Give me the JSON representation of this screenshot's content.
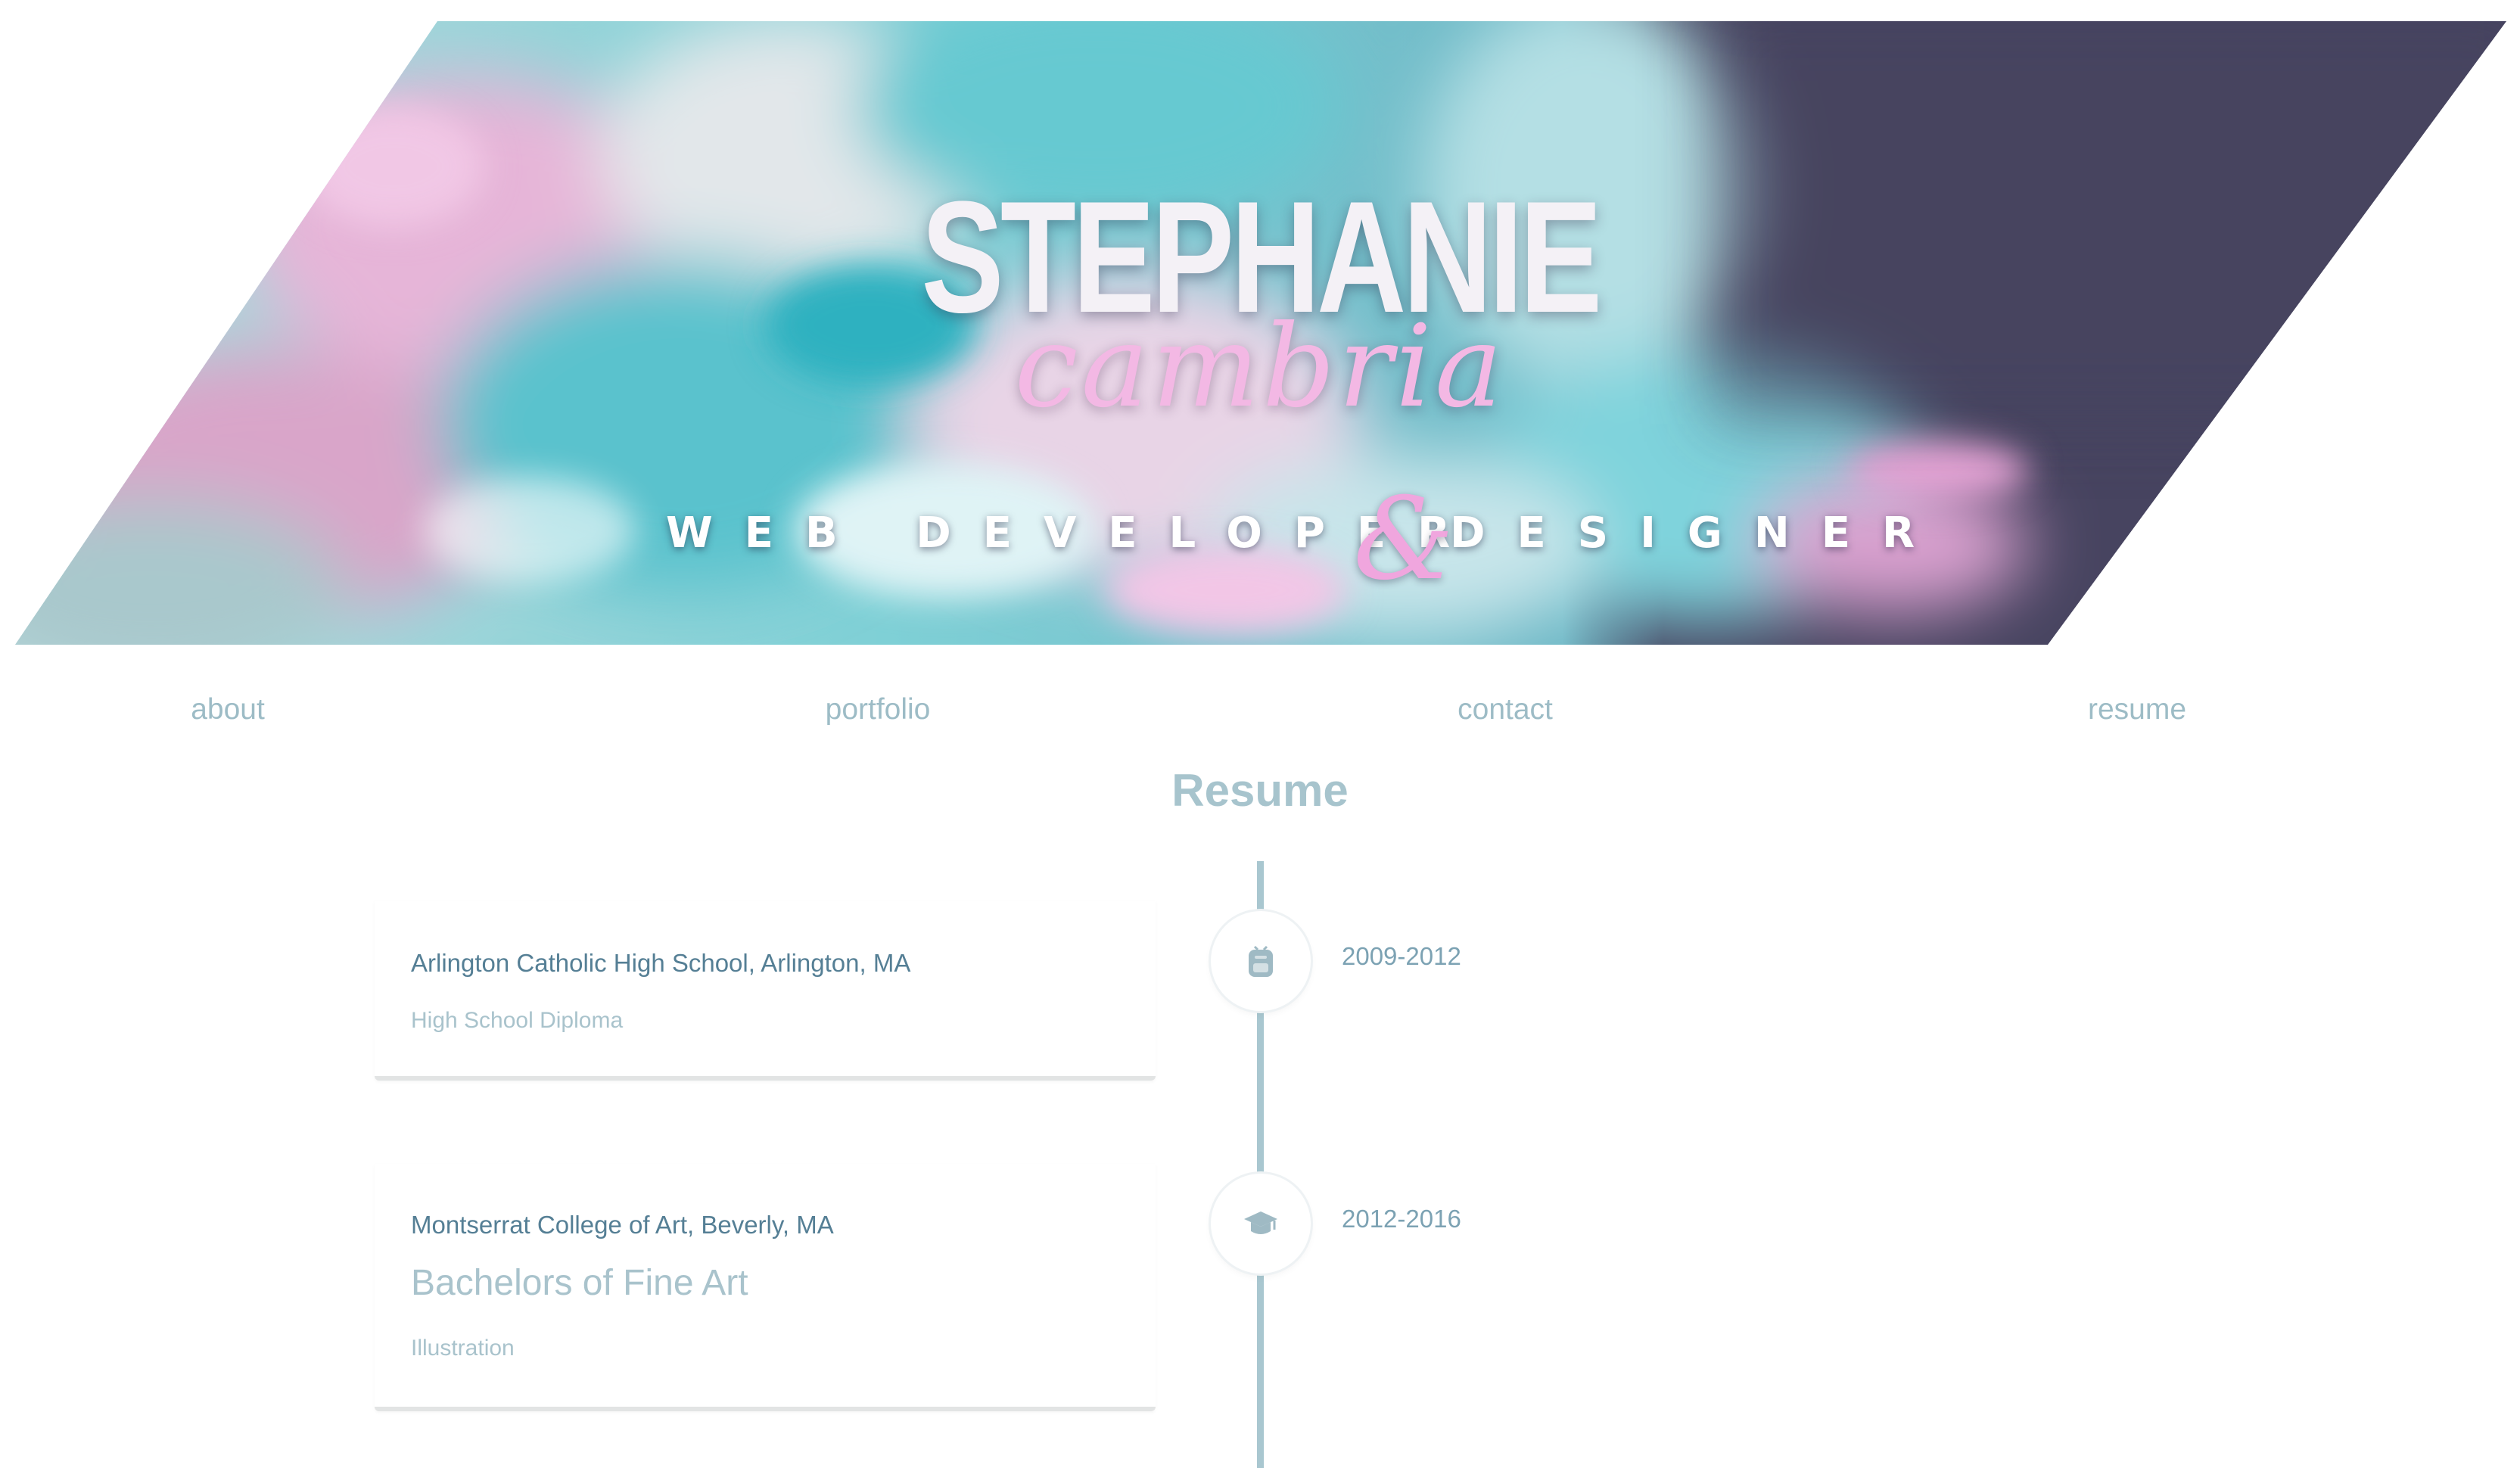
{
  "hero": {
    "first_name": "STEPHANIE",
    "last_name": "cambria",
    "tagline_part1": "WEB DEVELOPER",
    "tagline_amp": "&",
    "tagline_part2": "DESIGNER"
  },
  "nav": {
    "items": [
      {
        "label": "about"
      },
      {
        "label": "portfolio"
      },
      {
        "label": "contact"
      },
      {
        "label": "resume"
      }
    ]
  },
  "resume": {
    "title": "Resume",
    "entries": [
      {
        "school": "Arlington Catholic High School, Arlington, MA",
        "degree": "High School Diploma",
        "date": "2009-2012",
        "icon": "backpack-icon"
      },
      {
        "school": "Montserrat College of Art, Beverly, MA",
        "degree": "Bachelors of Fine Art",
        "field": "Illustration",
        "date": "2012-2016",
        "icon": "graduation-cap-icon"
      }
    ]
  },
  "colors": {
    "nav_text": "#9dbcc6",
    "timeline": "#a9c7d0",
    "school_text": "#557f95",
    "degree_text": "#a9c3cc",
    "hero_dark": "#474460",
    "hero_teal": "#5fc7cf",
    "hero_pink": "#e3a4cf"
  }
}
